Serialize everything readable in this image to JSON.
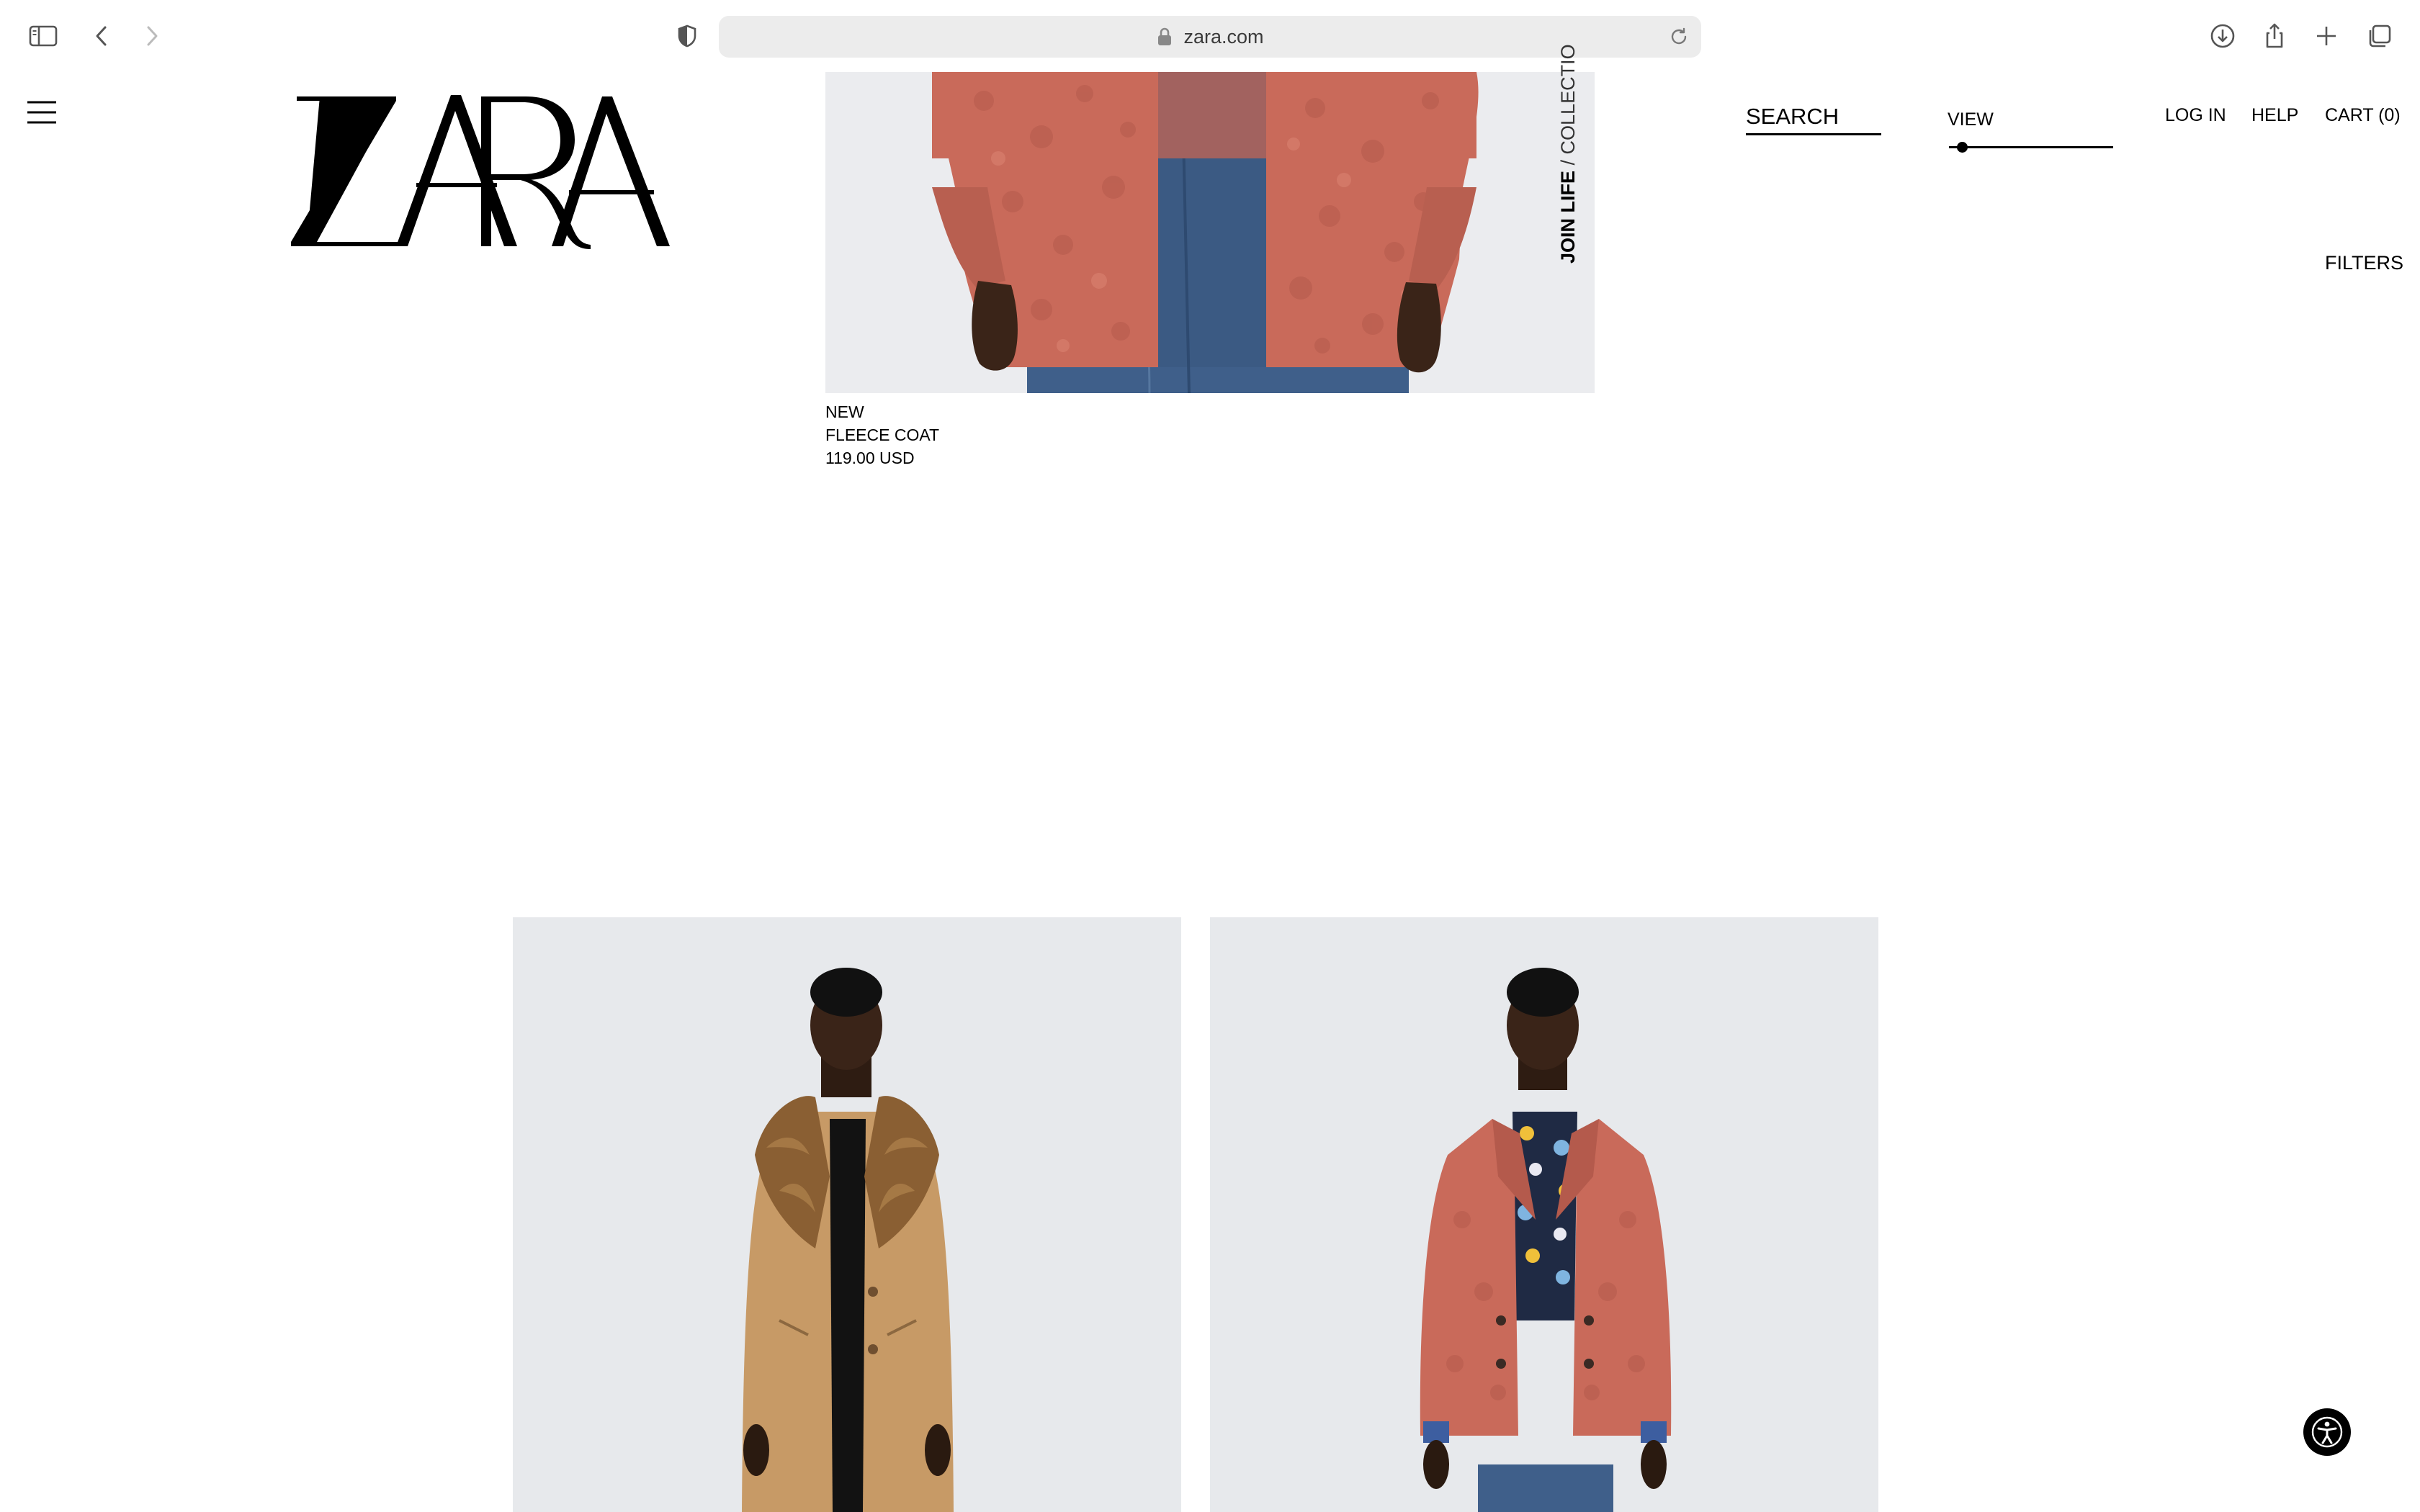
{
  "browser": {
    "url": "zara.com"
  },
  "header": {
    "logo_text": "ZARA",
    "search_label": "SEARCH",
    "view_label": "VIEW",
    "view_level": 0.05,
    "login_label": "LOG IN",
    "help_label": "HELP",
    "cart_label": "CART (0)",
    "filters_label": "FILTERS"
  },
  "featured_product": {
    "tag": "NEW",
    "name": "FLEECE COAT",
    "price": "119.00 USD",
    "badge_strong": "JOIN LIFE",
    "badge_light": "/ COLLECTIO"
  },
  "colors": {
    "fleece": "#c96a5a",
    "denim": "#3f5f8a",
    "camel": "#c79a66",
    "fur": "#8a5f33",
    "background_grey": "#e8eaed"
  },
  "icons": {
    "sidebar": "sidebar-icon",
    "back": "chevron-left-icon",
    "forward": "chevron-right-icon",
    "privacy": "shield-icon",
    "lock": "lock-icon",
    "reload": "reload-icon",
    "download": "download-icon",
    "share": "share-icon",
    "new_tab": "plus-icon",
    "tabs": "tabs-overview-icon",
    "menu": "hamburger-menu-icon",
    "accessibility": "accessibility-icon"
  }
}
